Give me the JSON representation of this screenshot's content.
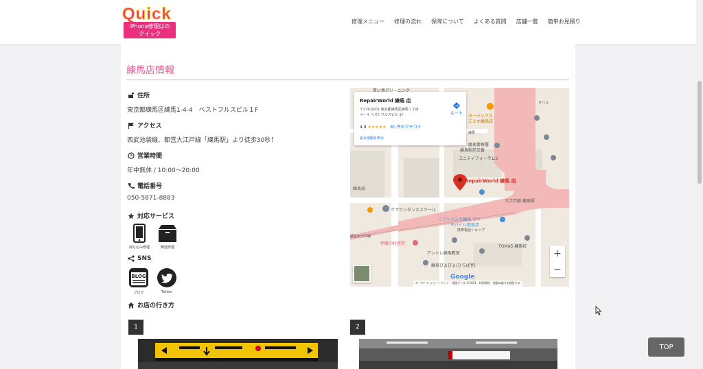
{
  "header": {
    "logo_text": "Quick",
    "logo_tagline_1": "iPhone修理はの",
    "logo_tagline_2": "クイック",
    "nav": [
      "修理メニュー",
      "修理の流れ",
      "保障について",
      "よくある質問",
      "店舗一覧",
      "簡単お見積り"
    ]
  },
  "page": {
    "title": "練馬店情報"
  },
  "info": {
    "address_label": "住所",
    "address": "東京都練馬区練馬1-4-4　ベストフルスビル１F",
    "access_label": "アクセス",
    "access": "西武池袋線、都営大江戸線「練馬駅」より徒歩30秒！",
    "hours_label": "営業時間",
    "hours": "年中無休 / 10:00～20:00",
    "phone_label": "電話番号",
    "phone": "050-5871-8883",
    "services_label": "対応サービス",
    "services": [
      "持ち込み修理",
      "郵送修理"
    ],
    "sns_label": "SNS",
    "sns": [
      {
        "icon_text": "BLOG",
        "label": "ブログ"
      },
      {
        "label": "Twitter"
      }
    ],
    "directions_label": "お店の行き方"
  },
  "map": {
    "place_name": "RepairWorld 練馬 店",
    "address_line1": "〒176-0001 東京都練馬区練馬１丁目",
    "address_line2": "４−４ ベストフルスビル 1F",
    "rating": "4.8",
    "stars": "★★★★★",
    "reviews": "80 件のクチコミ",
    "larger_map": "拡大地図を表示",
    "route": "ルート",
    "pin_label": "RepairWorld 練馬 店",
    "labels": {
      "cleaning": "青い鳥クリーニング",
      "starbucks_1": "ターバックス",
      "starbucks_2": "エミオ練馬店",
      "police": "練馬警察署",
      "koban": "練馬駅前交番",
      "unity": "ユニティフォーラム2",
      "oedo": "大江戸線 練馬駅",
      "crown": "クラウンダンススクール",
      "softbank_1": "ソフトバンク練馬 ワイ",
      "softbank_2": "モバイル取扱店",
      "ito": "伊藤内科医院",
      "tomas": "TOMAS 練馬校",
      "antore": "アントレ練馬教室",
      "piyopiyo": "練馬ぴよぴよ(ひろば室)",
      "oedo_line": "都営大江戸線",
      "school": "練馬校",
      "tabako": "タバコ",
      "nerima": "練馬",
      "kaitori": "携帯電話ショップ"
    },
    "google": "Google",
    "attribution": "キーボード ショートカット　地図データ ©2021　利用規約　地図の誤りを報告する",
    "zoom_in": "+",
    "zoom_out": "−"
  },
  "steps": [
    "1",
    "2"
  ],
  "top_button": "TOP",
  "colors": {
    "accent_pink": "#e6588f",
    "logo_pink": "#e92f7d",
    "logo_yellow": "#f9d21c",
    "map_rail": "#f3b9b9",
    "link_blue": "#1a73e8"
  }
}
